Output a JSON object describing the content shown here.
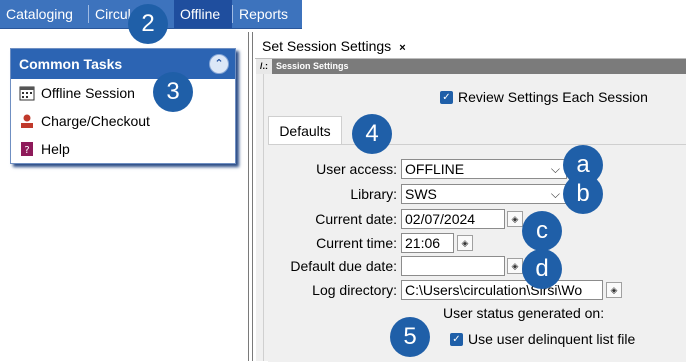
{
  "menu": {
    "items": [
      {
        "label": "Cataloging"
      },
      {
        "label": "Circul"
      },
      {
        "label": "Offline"
      },
      {
        "label": "Reports"
      }
    ]
  },
  "callouts": {
    "c2": "2",
    "c3": "3",
    "c4": "4",
    "c5": "5",
    "a": "a",
    "b": "b",
    "c": "c",
    "d": "d"
  },
  "tasks": {
    "title": "Common Tasks",
    "items": [
      {
        "label": "Offline Session"
      },
      {
        "label": "Charge/Checkout"
      },
      {
        "label": "Help"
      }
    ]
  },
  "session": {
    "tab_label": "Set Session Settings",
    "tab_close": "×",
    "window_title": "Session Settings",
    "review_label": "Review Settings Each Session",
    "defaults_tab": "Defaults",
    "fields": {
      "user_access_label": "User access:",
      "user_access_value": "OFFLINE",
      "library_label": "Library:",
      "library_value": "SWS",
      "current_date_label": "Current date:",
      "current_date_value": "02/07/2024",
      "current_time_label": "Current time:",
      "current_time_value": "21:06",
      "due_date_label": "Default due date:",
      "due_date_value": "",
      "log_dir_label": "Log directory:",
      "log_dir_value": "C:\\Users\\circulation\\Sirsi\\Wo"
    },
    "user_status_label": "User status generated on:",
    "delinquent_label": "Use user delinquent list file"
  },
  "colors": {
    "menubar": "#3d73bd",
    "callout": "#1f5fa8",
    "panel_header": "#2c64b3"
  }
}
